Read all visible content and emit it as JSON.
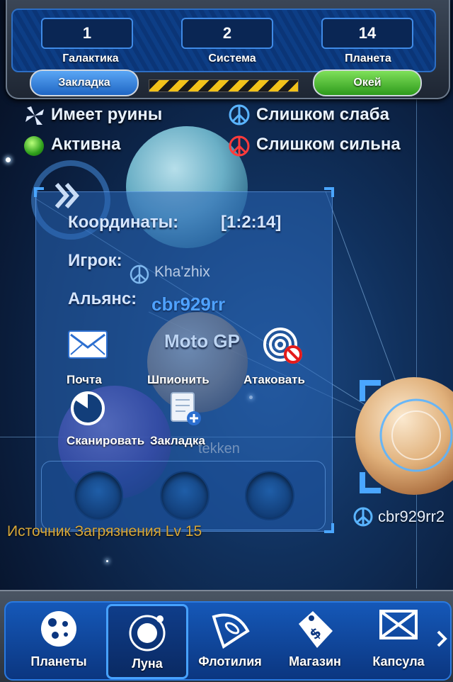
{
  "coords": {
    "galaxy": {
      "value": "1",
      "label": "Галактика"
    },
    "system": {
      "value": "2",
      "label": "Система"
    },
    "planet": {
      "value": "14",
      "label": "Планета"
    }
  },
  "buttons": {
    "bookmark": "Закладка",
    "ok": "Окей"
  },
  "legend": {
    "ruins": "Имеет руины",
    "active": "Активна",
    "too_weak": "Слишком слаба",
    "too_strong": "Слишком сильна"
  },
  "info": {
    "coordinates_label": "Координаты:",
    "coordinates_value": "[1:2:14]",
    "player_label": "Игрок:",
    "player_value": "Kha'zhix",
    "alliance_label": "Альянс:",
    "alliance_value": "cbr929rr",
    "moon_name": "Moto GP"
  },
  "actions": {
    "mail": "Почта",
    "spy": "Шпионить",
    "attack": "Атаковать",
    "scan": "Сканировать",
    "bookmark": "Закладка"
  },
  "map_labels": {
    "tekken": "tekken",
    "pollution": "Источник Загрязнения Lv 15",
    "selected_owner": "cbr929rr2"
  },
  "nav": {
    "planets": "Планеты",
    "moon": "Луна",
    "fleet": "Флотилия",
    "shop": "Магазин",
    "capsule": "Капсула"
  },
  "colors": {
    "bookmark_button": "#2f7fd8",
    "ok_button": "#3fb52c",
    "pollution_text": "#d8a83a"
  }
}
